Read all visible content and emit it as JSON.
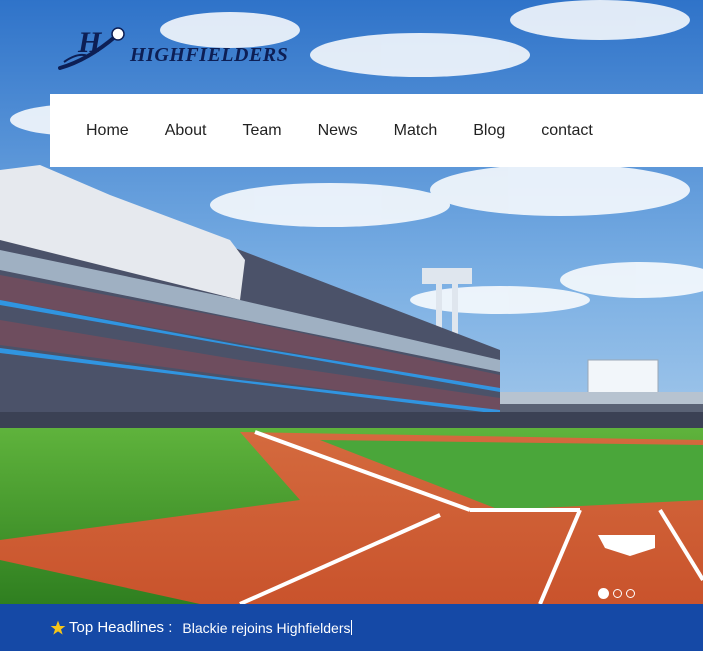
{
  "brand": {
    "name": "HIGHFIELDERS",
    "logo_icon": "baseball-bat-logo-icon"
  },
  "nav": {
    "items": [
      {
        "label": "Home"
      },
      {
        "label": "About"
      },
      {
        "label": "Team"
      },
      {
        "label": "News"
      },
      {
        "label": "Match"
      },
      {
        "label": "Blog"
      },
      {
        "label": "contact"
      }
    ]
  },
  "slider": {
    "slide_count": 3,
    "active_index": 0
  },
  "ticker": {
    "icon": "star-icon",
    "label": "Top Headlines :",
    "headline": "Blackie rejoins Highfielders"
  },
  "colors": {
    "navy": "#0d1f55",
    "ticker_bg": "#1549a6",
    "field_green": "#3f9c2b",
    "clay": "#d8643a"
  }
}
